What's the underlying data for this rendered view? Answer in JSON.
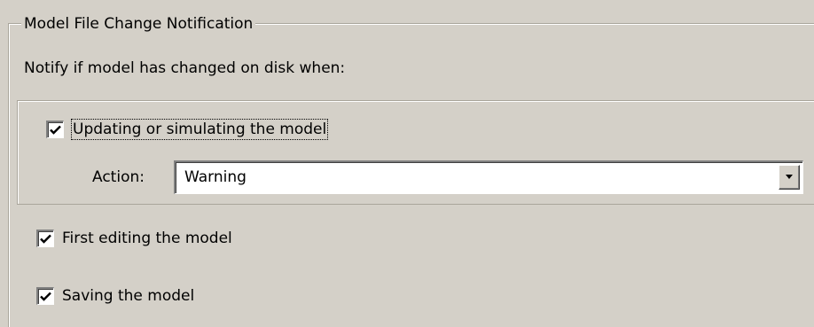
{
  "group": {
    "title": "Model File Change Notification"
  },
  "notify_label": "Notify if model has changed on disk when:",
  "options": {
    "updating": {
      "label": "Updating or simulating the model",
      "checked": true
    },
    "action": {
      "label": "Action:",
      "value": "Warning"
    },
    "first_editing": {
      "label": "First editing the model",
      "checked": true
    },
    "saving": {
      "label": "Saving the model",
      "checked": true
    }
  },
  "icons": {
    "check": "check-icon",
    "dropdown": "chevron-down-icon"
  }
}
